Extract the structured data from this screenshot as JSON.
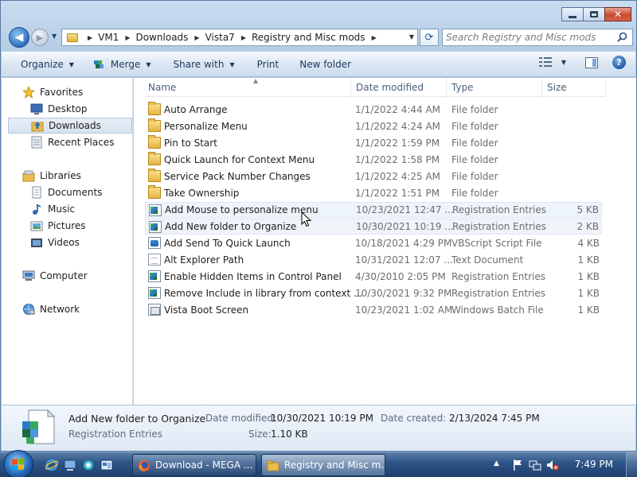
{
  "address": {
    "crumbs": [
      "VM1",
      "Downloads",
      "Vista7",
      "Registry and Misc mods"
    ]
  },
  "search": {
    "placeholder": "Search Registry and Misc mods"
  },
  "toolbar": {
    "organize": "Organize",
    "merge": "Merge",
    "share_with": "Share with",
    "print": "Print",
    "new_folder": "New folder"
  },
  "nav": {
    "favorites": "Favorites",
    "desktop": "Desktop",
    "downloads": "Downloads",
    "recent_places": "Recent Places",
    "libraries": "Libraries",
    "documents": "Documents",
    "music": "Music",
    "pictures": "Pictures",
    "videos": "Videos",
    "computer": "Computer",
    "network": "Network"
  },
  "columns": {
    "name": "Name",
    "date": "Date modified",
    "type": "Type",
    "size": "Size"
  },
  "files": [
    {
      "name": "Auto Arrange",
      "date": "1/1/2022 4:44 AM",
      "type": "File folder",
      "size": "",
      "icon": "folder-icon"
    },
    {
      "name": "Personalize Menu",
      "date": "1/1/2022 4:24 AM",
      "type": "File folder",
      "size": "",
      "icon": "folder-icon"
    },
    {
      "name": "Pin to Start",
      "date": "1/1/2022 1:59 PM",
      "type": "File folder",
      "size": "",
      "icon": "folder-icon"
    },
    {
      "name": "Quick Launch for Context Menu",
      "date": "1/1/2022 1:58 PM",
      "type": "File folder",
      "size": "",
      "icon": "folder-icon"
    },
    {
      "name": "Service Pack Number Changes",
      "date": "1/1/2022 4:25 AM",
      "type": "File folder",
      "size": "",
      "icon": "folder-icon"
    },
    {
      "name": "Take Ownership",
      "date": "1/1/2022 1:51 PM",
      "type": "File folder",
      "size": "",
      "icon": "folder-icon"
    },
    {
      "name": "Add Mouse to personalize menu",
      "date": "10/23/2021 12:47 ...",
      "type": "Registration Entries",
      "size": "5 KB",
      "icon": "registry-file-icon"
    },
    {
      "name": "Add New folder to Organize",
      "date": "10/30/2021 10:19 ...",
      "type": "Registration Entries",
      "size": "2 KB",
      "icon": "registry-file-icon"
    },
    {
      "name": "Add Send To Quick Launch",
      "date": "10/18/2021 4:29 PM",
      "type": "VBScript Script File",
      "size": "4 KB",
      "icon": "vbscript-file-icon"
    },
    {
      "name": "Alt Explorer Path",
      "date": "10/31/2021 12:07 ...",
      "type": "Text Document",
      "size": "1 KB",
      "icon": "text-file-icon"
    },
    {
      "name": "Enable Hidden Items in Control Panel",
      "date": "4/30/2010 2:05 PM",
      "type": "Registration Entries",
      "size": "1 KB",
      "icon": "registry-file-icon"
    },
    {
      "name": "Remove Include in library from context ...",
      "date": "10/30/2021 9:32 PM",
      "type": "Registration Entries",
      "size": "1 KB",
      "icon": "registry-file-icon"
    },
    {
      "name": "Vista Boot Screen",
      "date": "10/23/2021 1:02 AM",
      "type": "Windows Batch File",
      "size": "1 KB",
      "icon": "batch-file-icon"
    }
  ],
  "details": {
    "name": "Add New folder to Organize",
    "type": "Registration Entries",
    "date_modified_label": "Date modified:",
    "date_modified": "10/30/2021 10:19 PM",
    "date_created_label": "Date created:",
    "date_created": "2/13/2024 7:45 PM",
    "size_label": "Size:",
    "size": "1.10 KB"
  },
  "taskbar": {
    "tasks": [
      {
        "label": "Download - MEGA ...",
        "icon": "firefox-icon"
      },
      {
        "label": "Registry and Misc m...",
        "icon": "folder-icon"
      }
    ],
    "clock": "7:49 PM"
  },
  "colors": {
    "window_frame": "#c9dcf0",
    "taskbar": "#2f5588",
    "accent_selection": "#d7e2ef"
  }
}
